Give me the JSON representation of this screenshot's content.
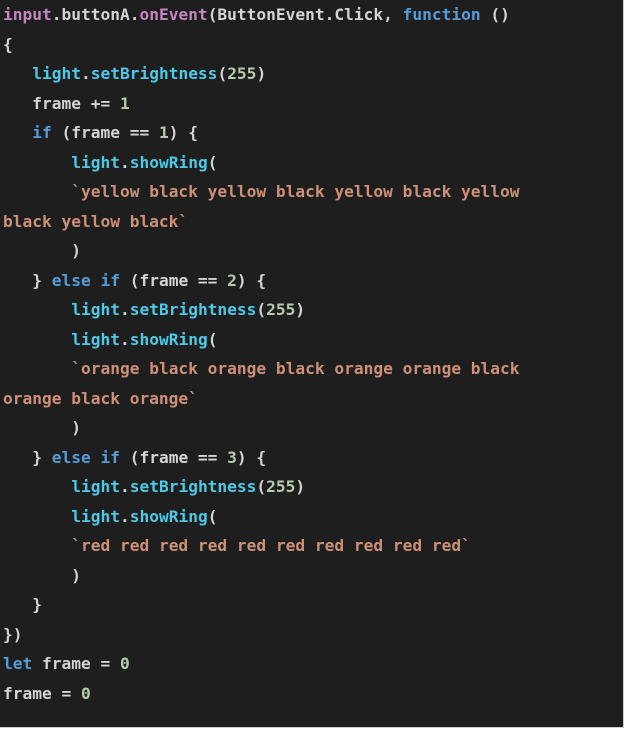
{
  "code": {
    "lines": [
      [
        {
          "c": "input",
          "t": "tok-input"
        },
        {
          "c": ".buttonA.",
          "t": "tok-plain"
        },
        {
          "c": "onEvent",
          "t": "tok-event"
        },
        {
          "c": "(ButtonEvent.Click, ",
          "t": "tok-plain"
        },
        {
          "c": "function",
          "t": "tok-keyword"
        },
        {
          "c": " ()",
          "t": "tok-plain"
        }
      ],
      [
        {
          "c": "{",
          "t": "tok-plain"
        }
      ],
      [
        {
          "c": "   ",
          "t": "tok-plain"
        },
        {
          "c": "light",
          "t": "tok-func"
        },
        {
          "c": ".",
          "t": "tok-plain"
        },
        {
          "c": "setBrightness",
          "t": "tok-func"
        },
        {
          "c": "(",
          "t": "tok-plain"
        },
        {
          "c": "255",
          "t": "tok-num"
        },
        {
          "c": ")",
          "t": "tok-plain"
        }
      ],
      [
        {
          "c": "   frame += ",
          "t": "tok-plain"
        },
        {
          "c": "1",
          "t": "tok-num"
        }
      ],
      [
        {
          "c": "   ",
          "t": "tok-plain"
        },
        {
          "c": "if",
          "t": "tok-keyword"
        },
        {
          "c": " (frame == ",
          "t": "tok-plain"
        },
        {
          "c": "1",
          "t": "tok-num"
        },
        {
          "c": ") {",
          "t": "tok-plain"
        }
      ],
      [
        {
          "c": "       ",
          "t": "tok-plain"
        },
        {
          "c": "light",
          "t": "tok-func"
        },
        {
          "c": ".",
          "t": "tok-plain"
        },
        {
          "c": "showRing",
          "t": "tok-func"
        },
        {
          "c": "(",
          "t": "tok-plain"
        }
      ],
      [
        {
          "c": "       ",
          "t": "tok-plain"
        },
        {
          "c": "`yellow black yellow black yellow black yellow",
          "t": "tok-str"
        }
      ],
      [
        {
          "c": "black yellow black`",
          "t": "tok-str"
        }
      ],
      [
        {
          "c": "       )",
          "t": "tok-plain"
        }
      ],
      [
        {
          "c": "   } ",
          "t": "tok-plain"
        },
        {
          "c": "else if",
          "t": "tok-keyword"
        },
        {
          "c": " (frame == ",
          "t": "tok-plain"
        },
        {
          "c": "2",
          "t": "tok-num"
        },
        {
          "c": ") {",
          "t": "tok-plain"
        }
      ],
      [
        {
          "c": "       ",
          "t": "tok-plain"
        },
        {
          "c": "light",
          "t": "tok-func"
        },
        {
          "c": ".",
          "t": "tok-plain"
        },
        {
          "c": "setBrightness",
          "t": "tok-func"
        },
        {
          "c": "(",
          "t": "tok-plain"
        },
        {
          "c": "255",
          "t": "tok-num"
        },
        {
          "c": ")",
          "t": "tok-plain"
        }
      ],
      [
        {
          "c": "       ",
          "t": "tok-plain"
        },
        {
          "c": "light",
          "t": "tok-func"
        },
        {
          "c": ".",
          "t": "tok-plain"
        },
        {
          "c": "showRing",
          "t": "tok-func"
        },
        {
          "c": "(",
          "t": "tok-plain"
        }
      ],
      [
        {
          "c": "       ",
          "t": "tok-plain"
        },
        {
          "c": "`orange black orange black orange orange black",
          "t": "tok-str"
        }
      ],
      [
        {
          "c": "orange black orange`",
          "t": "tok-str"
        }
      ],
      [
        {
          "c": "       )",
          "t": "tok-plain"
        }
      ],
      [
        {
          "c": "   } ",
          "t": "tok-plain"
        },
        {
          "c": "else if",
          "t": "tok-keyword"
        },
        {
          "c": " (frame == ",
          "t": "tok-plain"
        },
        {
          "c": "3",
          "t": "tok-num"
        },
        {
          "c": ") {",
          "t": "tok-plain"
        }
      ],
      [
        {
          "c": "       ",
          "t": "tok-plain"
        },
        {
          "c": "light",
          "t": "tok-func"
        },
        {
          "c": ".",
          "t": "tok-plain"
        },
        {
          "c": "setBrightness",
          "t": "tok-func"
        },
        {
          "c": "(",
          "t": "tok-plain"
        },
        {
          "c": "255",
          "t": "tok-num"
        },
        {
          "c": ")",
          "t": "tok-plain"
        }
      ],
      [
        {
          "c": "       ",
          "t": "tok-plain"
        },
        {
          "c": "light",
          "t": "tok-func"
        },
        {
          "c": ".",
          "t": "tok-plain"
        },
        {
          "c": "showRing",
          "t": "tok-func"
        },
        {
          "c": "(",
          "t": "tok-plain"
        }
      ],
      [
        {
          "c": "       ",
          "t": "tok-plain"
        },
        {
          "c": "`red red red red red red red red red red`",
          "t": "tok-str"
        }
      ],
      [
        {
          "c": "       )",
          "t": "tok-plain"
        }
      ],
      [
        {
          "c": "   }",
          "t": "tok-plain"
        }
      ],
      [
        {
          "c": "})",
          "t": "tok-plain"
        }
      ],
      [
        {
          "c": "let",
          "t": "tok-keyword"
        },
        {
          "c": " frame = ",
          "t": "tok-plain"
        },
        {
          "c": "0",
          "t": "tok-num"
        }
      ],
      [
        {
          "c": "frame = ",
          "t": "tok-plain"
        },
        {
          "c": "0",
          "t": "tok-num"
        }
      ]
    ]
  },
  "colors": {
    "background": "#1e1e1e",
    "keyword": "#569cd6",
    "function": "#4ec9e6",
    "number": "#b5cea8",
    "string": "#ce9178",
    "plain": "#d4d4d4",
    "input": "#c586c0"
  }
}
